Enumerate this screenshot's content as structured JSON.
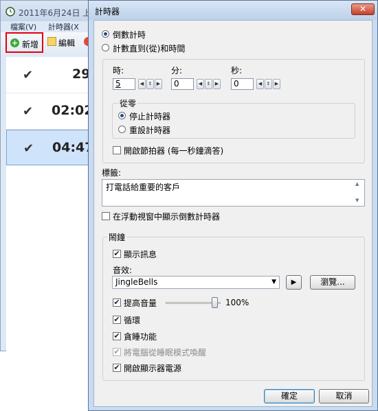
{
  "bg_window": {
    "title": "2011年6月24日 上",
    "menu": [
      "檔案(V)",
      "計時器(X"
    ],
    "toolbar": {
      "add_label": "新增",
      "edit_label": "編輯"
    },
    "rows": [
      {
        "check": "✔",
        "time": "29"
      },
      {
        "check": "✔",
        "time": "02:02"
      },
      {
        "check": "✔",
        "time": "04:47"
      }
    ]
  },
  "dialog": {
    "title": "計時器",
    "close_label": "✕",
    "mode": {
      "countdown_label": "倒數計時",
      "countto_label": "計數直到(從)和時間",
      "selected": "countdown"
    },
    "time": {
      "hours_label": "時:",
      "minutes_label": "分:",
      "seconds_label": "秒:",
      "hours_value": "5",
      "minutes_value": "0",
      "seconds_value": "0"
    },
    "from_zero": {
      "title": "從零",
      "stop_label": "停止計時器",
      "reset_label": "重設計時器",
      "selected": "stop"
    },
    "metronome_label": "開啟節拍器 (每一秒鐘滴答)",
    "tag": {
      "label": "標籤:",
      "value": "打電話給重要的客戶"
    },
    "float_label": "在浮動視窗中顯示倒數計時器",
    "alarm": {
      "title": "鬧鐘",
      "show_msg_label": "顯示訊息",
      "sound_label": "音效:",
      "sound_value": "JingleBells",
      "play_label": "▶",
      "browse_label": "瀏覽...",
      "raise_volume_label": "提高音量",
      "volume_percent": "100%",
      "volume_fraction": 1.0,
      "loop_label": "循環",
      "snooze_label": "貪睡功能",
      "wake_label": "將電腦從睡眠模式喚醒",
      "monitor_label": "開啟顯示器電源"
    },
    "ok_label": "確定",
    "cancel_label": "取消"
  }
}
